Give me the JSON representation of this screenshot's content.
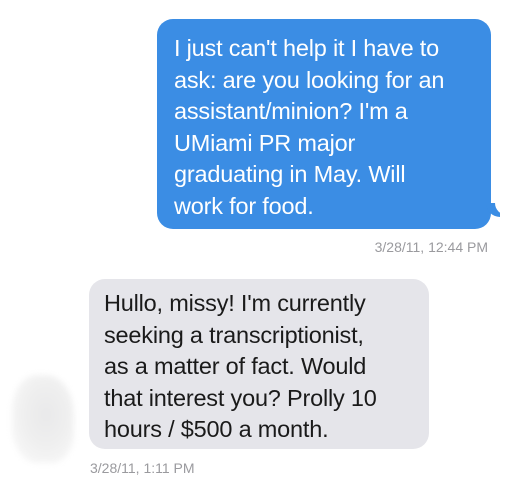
{
  "messages": [
    {
      "direction": "sent",
      "text": "I just can't help it I have to\nask: are you looking for an\nassistant/minion? I'm a\nUMiami PR major\ngraduating in May. Will\nwork for food.",
      "timestamp": "3/28/11, 12:44 PM"
    },
    {
      "direction": "received",
      "text": "Hullo, missy! I'm currently\nseeking a transcriptionist,\nas a matter of fact. Would\nthat interest you? Prolly 10\nhours / $500 a month.",
      "timestamp": "3/28/11, 1:11 PM"
    }
  ],
  "colors": {
    "sent_bubble": "#3b8de4",
    "received_bubble": "#e5e5ea",
    "timestamp": "#9a9a9e"
  }
}
